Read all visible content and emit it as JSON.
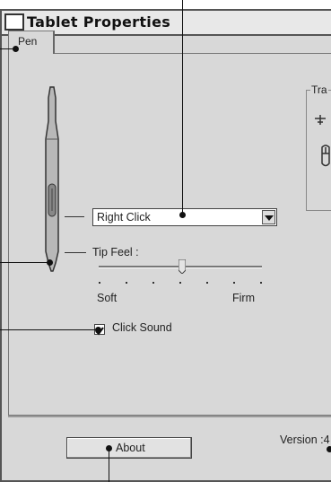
{
  "window": {
    "title": "Tablet Properties"
  },
  "tabs": [
    {
      "label": "Pen"
    }
  ],
  "pen_settings": {
    "button_function": "Right Click",
    "tip_feel_label": "Tip Feel :",
    "tip_feel_min": "Soft",
    "tip_feel_max": "Firm",
    "tip_feel_value": 0.5,
    "click_sound_label": "Click Sound",
    "click_sound_checked": true
  },
  "tracking_group": {
    "label": "Tra"
  },
  "footer": {
    "about_label": "About",
    "version_label": "Version :4"
  },
  "icons": [
    "pen-icon",
    "dropdown-arrow-icon",
    "slider-thumb-icon",
    "mouse-icon"
  ]
}
